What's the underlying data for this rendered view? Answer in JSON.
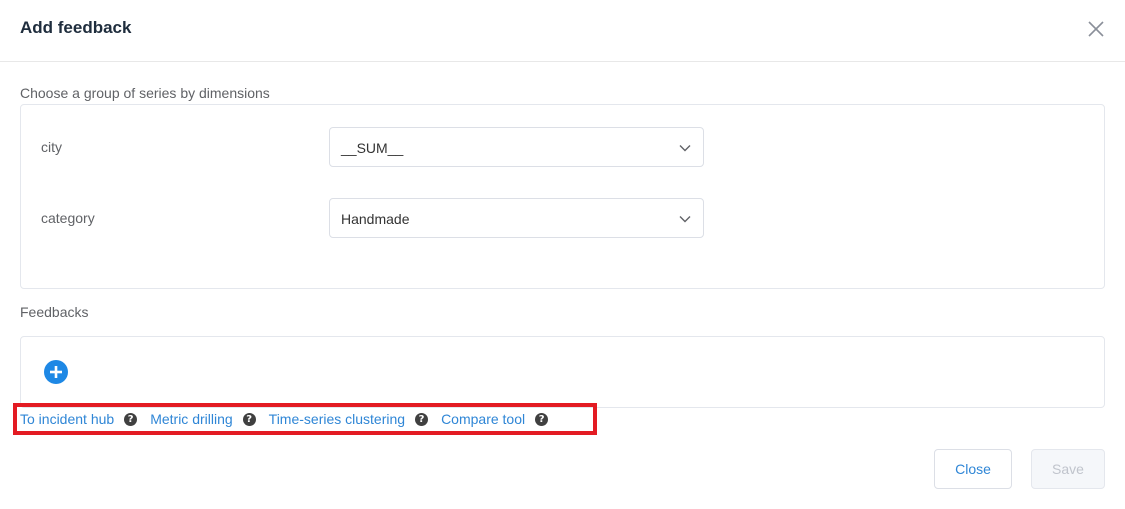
{
  "dialog": {
    "title": "Add feedback"
  },
  "dimensions": {
    "section_label": "Choose a group of series by dimensions",
    "rows": [
      {
        "label": "city",
        "selected": "__SUM__"
      },
      {
        "label": "category",
        "selected": "Handmade"
      }
    ]
  },
  "feedbacks": {
    "section_label": "Feedbacks"
  },
  "links": [
    {
      "label": "To incident hub",
      "help": "?"
    },
    {
      "label": "Metric drilling",
      "help": "?"
    },
    {
      "label": "Time-series clustering",
      "help": "?"
    },
    {
      "label": "Compare tool",
      "help": "?"
    }
  ],
  "footer": {
    "close_label": "Close",
    "save_label": "Save"
  },
  "colors": {
    "accent": "#2f86d6",
    "add_button": "#1e88e5",
    "highlight_border": "#e31b23"
  }
}
